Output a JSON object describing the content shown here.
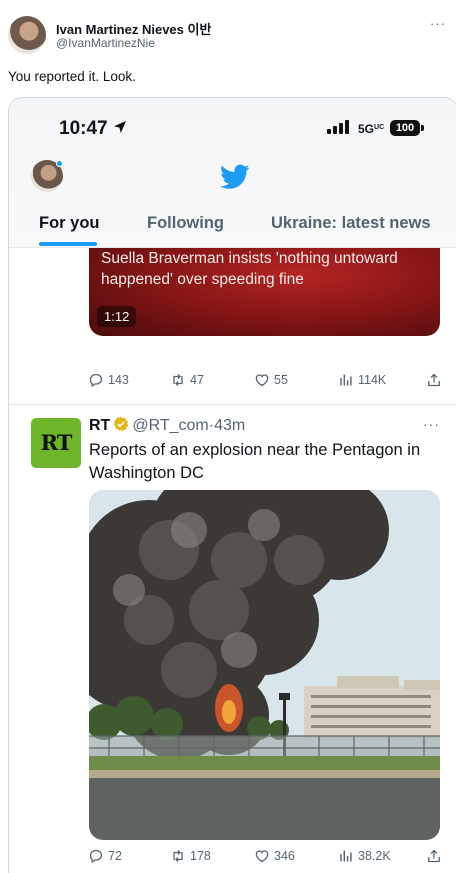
{
  "outer": {
    "author_name": "Ivan Martinez Nieves 이반",
    "author_handle": "@IvanMartinezNie",
    "more_label": "···",
    "text": "You reported it. Look."
  },
  "status": {
    "time": "10:47",
    "network": "5G",
    "network_suffix": "UC",
    "battery": "100"
  },
  "tabs": [
    {
      "label": "For you",
      "active": true
    },
    {
      "label": "Following",
      "active": false
    },
    {
      "label": "Ukraine: latest news",
      "active": false
    }
  ],
  "video_tweet": {
    "caption": "Suella Braverman insists 'nothing untoward happened' over speeding fine",
    "duration": "1:12",
    "replies": "143",
    "retweets": "47",
    "likes": "55",
    "views": "114K"
  },
  "rt_tweet": {
    "logo_text": "RT",
    "name": "RT",
    "handle": "@RT_com",
    "separator": "·",
    "age": "43m",
    "more_label": "···",
    "text": "Reports of an explosion near the Pentagon in Washington DC",
    "replies": "72",
    "retweets": "178",
    "likes": "346",
    "views": "38.2K"
  },
  "colors": {
    "accent": "#1d9bf0",
    "rt_green": "#6fb52c",
    "muted": "#536471",
    "verified_gold": "#e2b719"
  },
  "icons": [
    "location-arrow-icon",
    "signal-icon",
    "twitter-bird-icon",
    "verified-badge-icon",
    "reply-icon",
    "retweet-icon",
    "like-icon",
    "views-icon",
    "share-icon"
  ]
}
